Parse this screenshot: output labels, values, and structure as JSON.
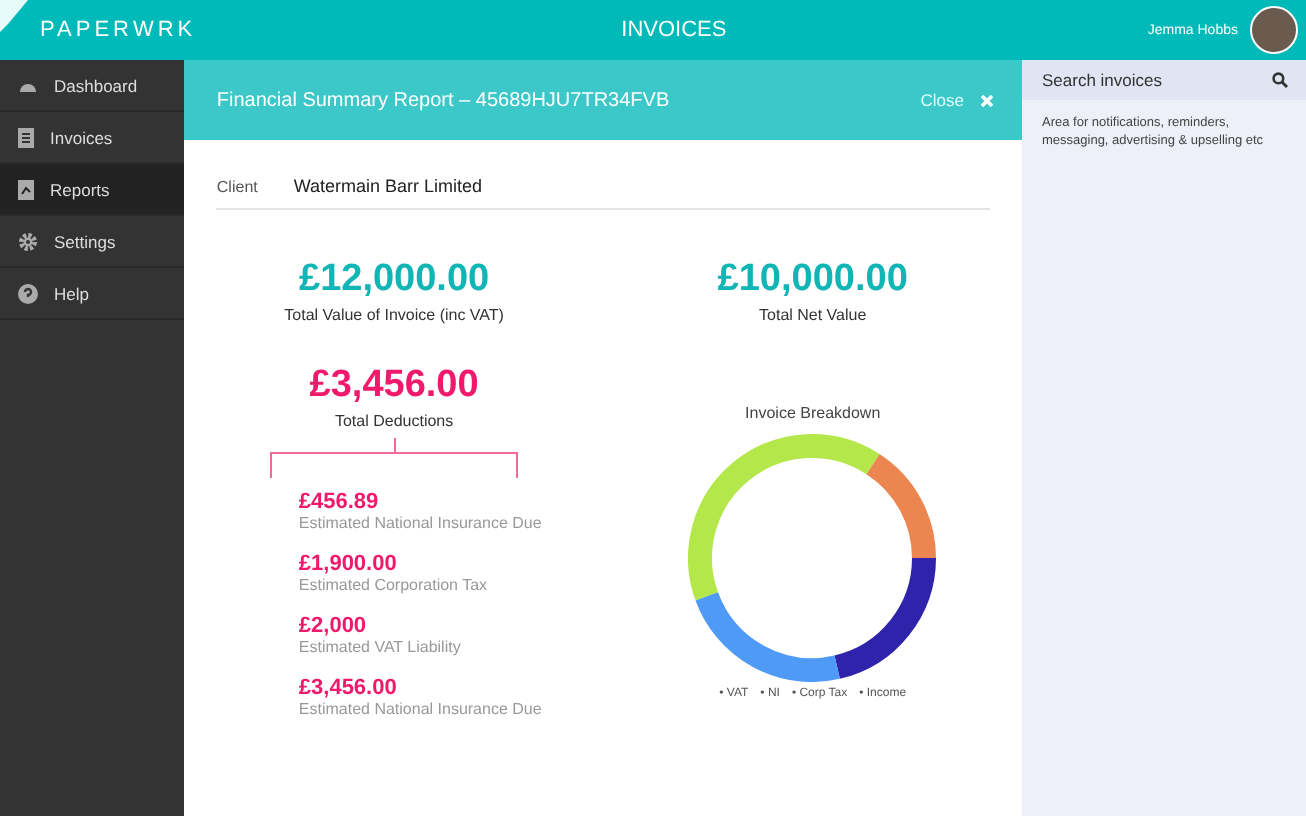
{
  "topbar": {
    "logo": "**PAPER**WRK",
    "title": "INVOICES",
    "user_name": "Jemma Hobbs"
  },
  "sidebar": {
    "items": [
      {
        "label": "Dashboard",
        "selected": false
      },
      {
        "label": "Invoices",
        "selected": false
      },
      {
        "label": "Reports",
        "selected": true
      },
      {
        "label": "Settings",
        "selected": false
      },
      {
        "label": "Help",
        "selected": false
      }
    ]
  },
  "report": {
    "title": "Financial Summary Report – 45689HJU7TR34FVB",
    "close_label": "Close",
    "client_label": "Client",
    "client_value": "Watermain Barr Limited",
    "totals": [
      {
        "amount": "£12,000.00",
        "label": "Total Value of Invoice (inc VAT)"
      },
      {
        "amount": "£10,000.00",
        "label": "Total Net Value"
      }
    ],
    "deductions": {
      "amount": "£3,456.00",
      "label": "Total Deductions",
      "items": [
        {
          "amount": "£456.89",
          "label": "Estimated National Insurance Due"
        },
        {
          "amount": "£1,900.00",
          "label": "Estimated Corporation Tax"
        },
        {
          "amount": "£2,000",
          "label": "Estimated VAT Liability"
        },
        {
          "amount": "£3,456.00",
          "label": "Estimated National Insurance Due"
        }
      ]
    },
    "breakdown": {
      "title": "Invoice Breakdown",
      "legend": [
        "• VAT",
        "• NI",
        "• Corp Tax",
        "• Income"
      ]
    }
  },
  "right_panel": {
    "search_placeholder": "Search invoices",
    "note": "Area for notifications, reminders, messaging, advertising & upselling etc"
  }
}
